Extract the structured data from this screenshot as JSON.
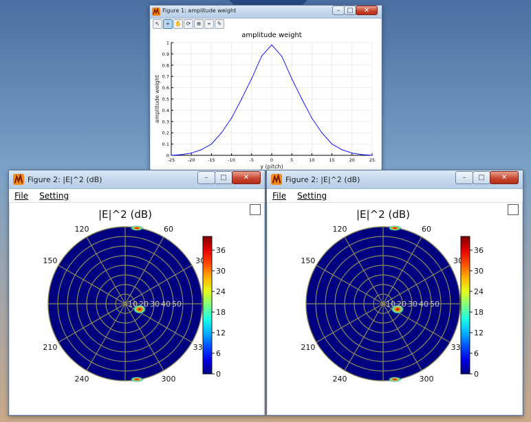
{
  "windows": {
    "weight": {
      "title": "Figure 1: amplitude weight",
      "toolbar_icons": [
        "pointer-icon",
        "zoom-icon",
        "pan-icon",
        "rotate-icon",
        "zoom-box-icon",
        "datatip-icon",
        "brush-icon"
      ]
    },
    "polar_left": {
      "title": "Figure 2: |E|^2 (dB)",
      "menu": [
        "File",
        "Setting"
      ]
    },
    "polar_right": {
      "title": "Figure 2: |E|^2 (dB)",
      "menu": [
        "File",
        "Setting"
      ]
    }
  },
  "chart_data": [
    {
      "type": "line",
      "title": "amplitude weight",
      "xlabel": "y (pitch)",
      "ylabel": "amplitude weight",
      "xlim": [
        -25,
        25
      ],
      "ylim": [
        0,
        1
      ],
      "xticks": [
        "-25",
        "-20",
        "-15",
        "-10",
        "-5",
        "0",
        "5",
        "10",
        "15",
        "20",
        "25"
      ],
      "yticks": [
        "0",
        "0.1",
        "0.2",
        "0.3",
        "0.4",
        "0.5",
        "0.6",
        "0.7",
        "0.8",
        "0.9",
        "1"
      ],
      "grid": true,
      "color": "#0000ff",
      "x": [
        -25,
        -22.5,
        -20,
        -17.5,
        -15,
        -12.5,
        -10,
        -7.5,
        -5,
        -2.5,
        0,
        2.5,
        5,
        7.5,
        10,
        12.5,
        15,
        17.5,
        20,
        22.5,
        25
      ],
      "y": [
        0,
        0.006,
        0.02,
        0.05,
        0.1,
        0.2,
        0.33,
        0.5,
        0.68,
        0.88,
        0.98,
        0.88,
        0.68,
        0.5,
        0.33,
        0.2,
        0.1,
        0.05,
        0.02,
        0.006,
        0
      ]
    },
    {
      "type": "heatmap",
      "title": "|E|^2 (dB)",
      "angle_labels": [
        "30",
        "60",
        "120",
        "150",
        "210",
        "240",
        "300",
        "330"
      ],
      "radial_labels": [
        "10",
        "20",
        "30",
        "40",
        "50"
      ],
      "colorbar_ticks": [
        "0",
        "6",
        "12",
        "18",
        "24",
        "30",
        "36"
      ],
      "colorbar_range": [
        0,
        40
      ],
      "background_level": 0
    },
    {
      "type": "heatmap",
      "title": "|E|^2 (dB)",
      "angle_labels": [
        "30",
        "60",
        "120",
        "150",
        "210",
        "240",
        "300",
        "330"
      ],
      "radial_labels": [
        "10",
        "20",
        "30",
        "40",
        "50"
      ],
      "colorbar_ticks": [
        "0",
        "6",
        "12",
        "18",
        "24",
        "30",
        "36"
      ],
      "colorbar_range": [
        0,
        40
      ],
      "background_level": 0
    }
  ]
}
